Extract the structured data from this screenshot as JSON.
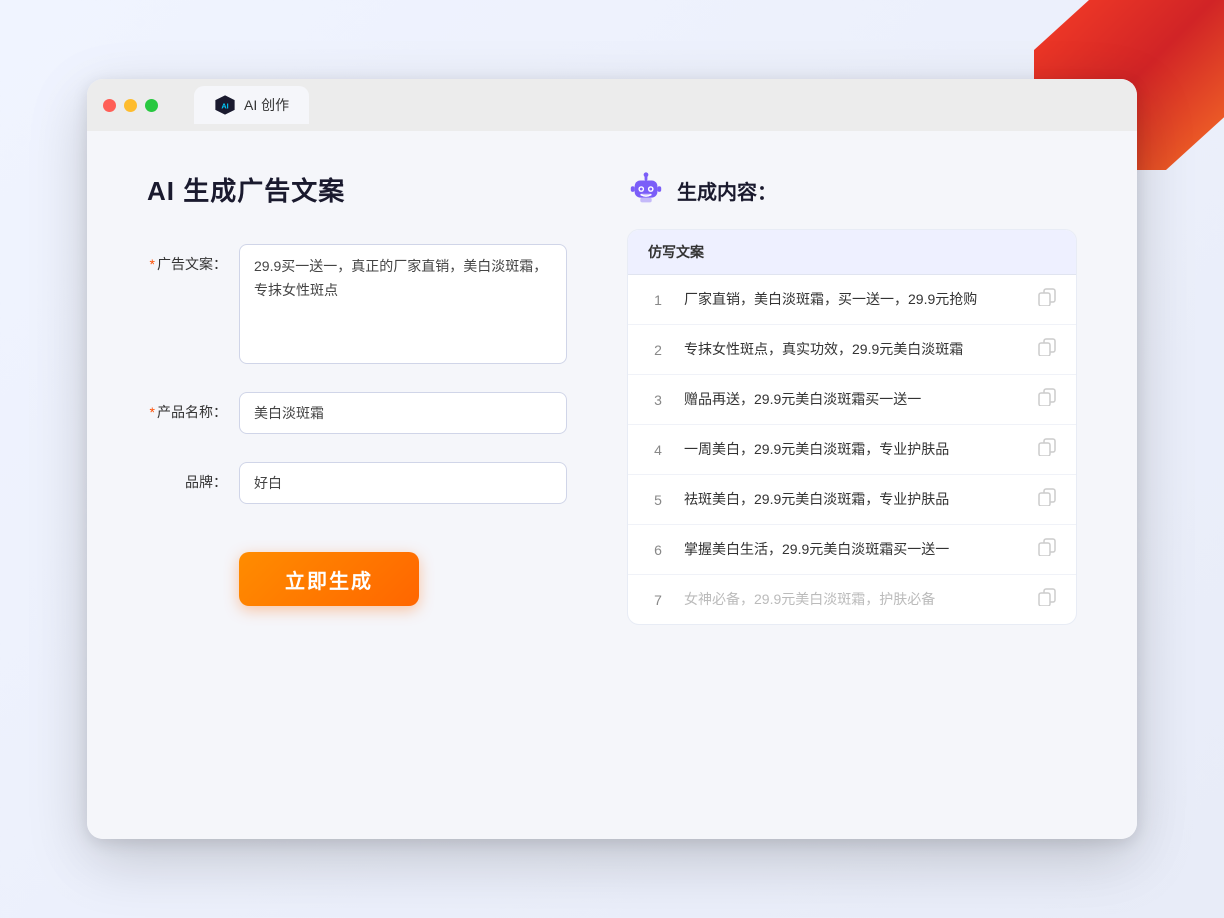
{
  "browser": {
    "tab_label": "AI 创作",
    "traffic_lights": [
      "red",
      "yellow",
      "green"
    ]
  },
  "left": {
    "page_title": "AI 生成广告文案",
    "fields": [
      {
        "label": "广告文案：",
        "required": true,
        "type": "textarea",
        "value": "29.9买一送一，真正的厂家直销，美白淡斑霜，专抹女性斑点",
        "name": "ad-copy-field"
      },
      {
        "label": "产品名称：",
        "required": true,
        "type": "input",
        "value": "美白淡斑霜",
        "name": "product-name-field"
      },
      {
        "label": "品牌：",
        "required": false,
        "type": "input",
        "value": "好白",
        "name": "brand-field"
      }
    ],
    "button_label": "立即生成"
  },
  "right": {
    "title": "生成内容：",
    "table_header": "仿写文案",
    "results": [
      {
        "num": "1",
        "text": "厂家直销，美白淡斑霜，买一送一，29.9元抢购",
        "faded": false
      },
      {
        "num": "2",
        "text": "专抹女性斑点，真实功效，29.9元美白淡斑霜",
        "faded": false
      },
      {
        "num": "3",
        "text": "赠品再送，29.9元美白淡斑霜买一送一",
        "faded": false
      },
      {
        "num": "4",
        "text": "一周美白，29.9元美白淡斑霜，专业护肤品",
        "faded": false
      },
      {
        "num": "5",
        "text": "祛斑美白，29.9元美白淡斑霜，专业护肤品",
        "faded": false
      },
      {
        "num": "6",
        "text": "掌握美白生活，29.9元美白淡斑霜买一送一",
        "faded": false
      },
      {
        "num": "7",
        "text": "女神必备，29.9元美白淡斑霜，护肤必备",
        "faded": true
      }
    ]
  }
}
